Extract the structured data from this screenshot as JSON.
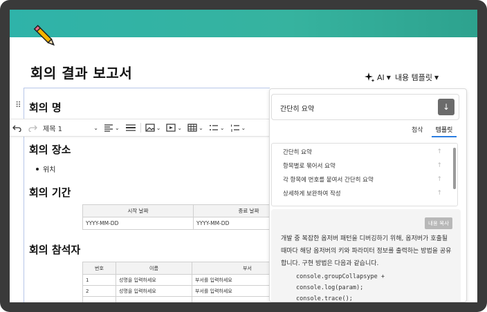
{
  "document": {
    "title": "회의 결과 보고서",
    "sections": {
      "meeting_name": "회의 명",
      "location": "회의 장소",
      "location_bullet": "위치",
      "period": "회의 기간",
      "attendees": "회의 참석자"
    }
  },
  "top_actions": {
    "ai_label": "AI",
    "template_label": "내용 템플릿"
  },
  "toolbar": {
    "heading_select": "제목 1"
  },
  "period_table": {
    "headers": [
      "시작 날짜",
      "종료 날짜"
    ],
    "row": [
      "YYYY-MM-DD",
      "YYYY-MM-DD"
    ]
  },
  "attendees_table": {
    "headers": [
      "번호",
      "이름",
      "부서"
    ],
    "rows": [
      [
        "1",
        "성명을 입력하세요",
        "부서를 입력하세요"
      ],
      [
        "2",
        "성명을 입력하세요",
        "부서를 입력하세요"
      ]
    ]
  },
  "ai_panel": {
    "prompt_value": "간단히 요약",
    "tabs": [
      "첨삭",
      "템플릿"
    ],
    "active_tab": "템플릿",
    "suggestions": [
      "간단히 요약",
      "항목별로 묶어서 요약",
      "각 항목에 번호를 붙여서 간단히 요약",
      "상세하게 보완하여 작성"
    ],
    "copy_button": "내용 복사",
    "detail_text": "개발 중 복잡한 옵저버 패턴을 디버깅하기 위해, 옵저버가 호출될 때마다 해당 옵저버의 키와 파라미터 정보를 출력하는 방법을 공유합니다. 구현 방법은 다음과 같습니다.",
    "code_lines": [
      "console.groupCollapsype +",
      "console.log(param);",
      "console.trace();"
    ]
  },
  "colors": {
    "banner": "#2fb3a9",
    "accent_tab": "#2a7de1",
    "send_button": "#6b6b6b"
  }
}
